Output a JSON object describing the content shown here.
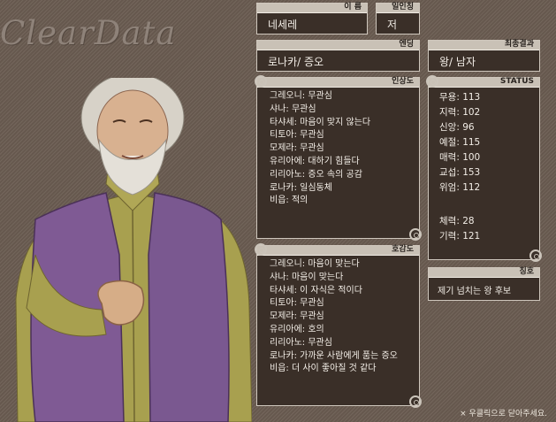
{
  "logo": "ClearData",
  "name_box": {
    "label": "이 름",
    "value": "네세레"
  },
  "pronoun_box": {
    "label": "일인칭",
    "value": "저"
  },
  "ending_box": {
    "label": "엔딩",
    "value": "로나카/ 증오"
  },
  "final_box": {
    "label": "최종결과",
    "value": "왕/ 남자"
  },
  "impression": {
    "label": "인상도",
    "items": [
      "그레오니: 무관심",
      "샤나: 무관심",
      "타샤세: 마음이 맞지 않는다",
      "티토아: 무관심",
      "모제라: 무관심",
      "유리아에: 대하기 힘들다",
      "리리아노: 증오 속의 공감",
      "로나카: 일심동체",
      "비읍: 적의"
    ]
  },
  "affection": {
    "label": "호감도",
    "items": [
      "그레오니: 마음이 맞는다",
      "샤나: 마음이 맞는다",
      "타샤세: 이 자식은 적이다",
      "티토아: 무관심",
      "모제라: 무관심",
      "유리아에: 호의",
      "리리아노: 무관심",
      "로나카: 가까운 사람에게 품는 증오",
      "비읍: 더 사이 좋아질 것 같다"
    ]
  },
  "status": {
    "label": "STATUS",
    "stats": [
      "무용: 113",
      "지력: 102",
      "신앙: 96",
      "예절: 115",
      "매력: 100",
      "교섭: 153",
      "위엄: 112"
    ],
    "extra": [
      "체력: 28",
      "기력: 121"
    ]
  },
  "title_box": {
    "label": "칭호",
    "value": "제기 넘치는 왕 후보"
  },
  "footer": "× 우클릭으로 닫아주세요."
}
